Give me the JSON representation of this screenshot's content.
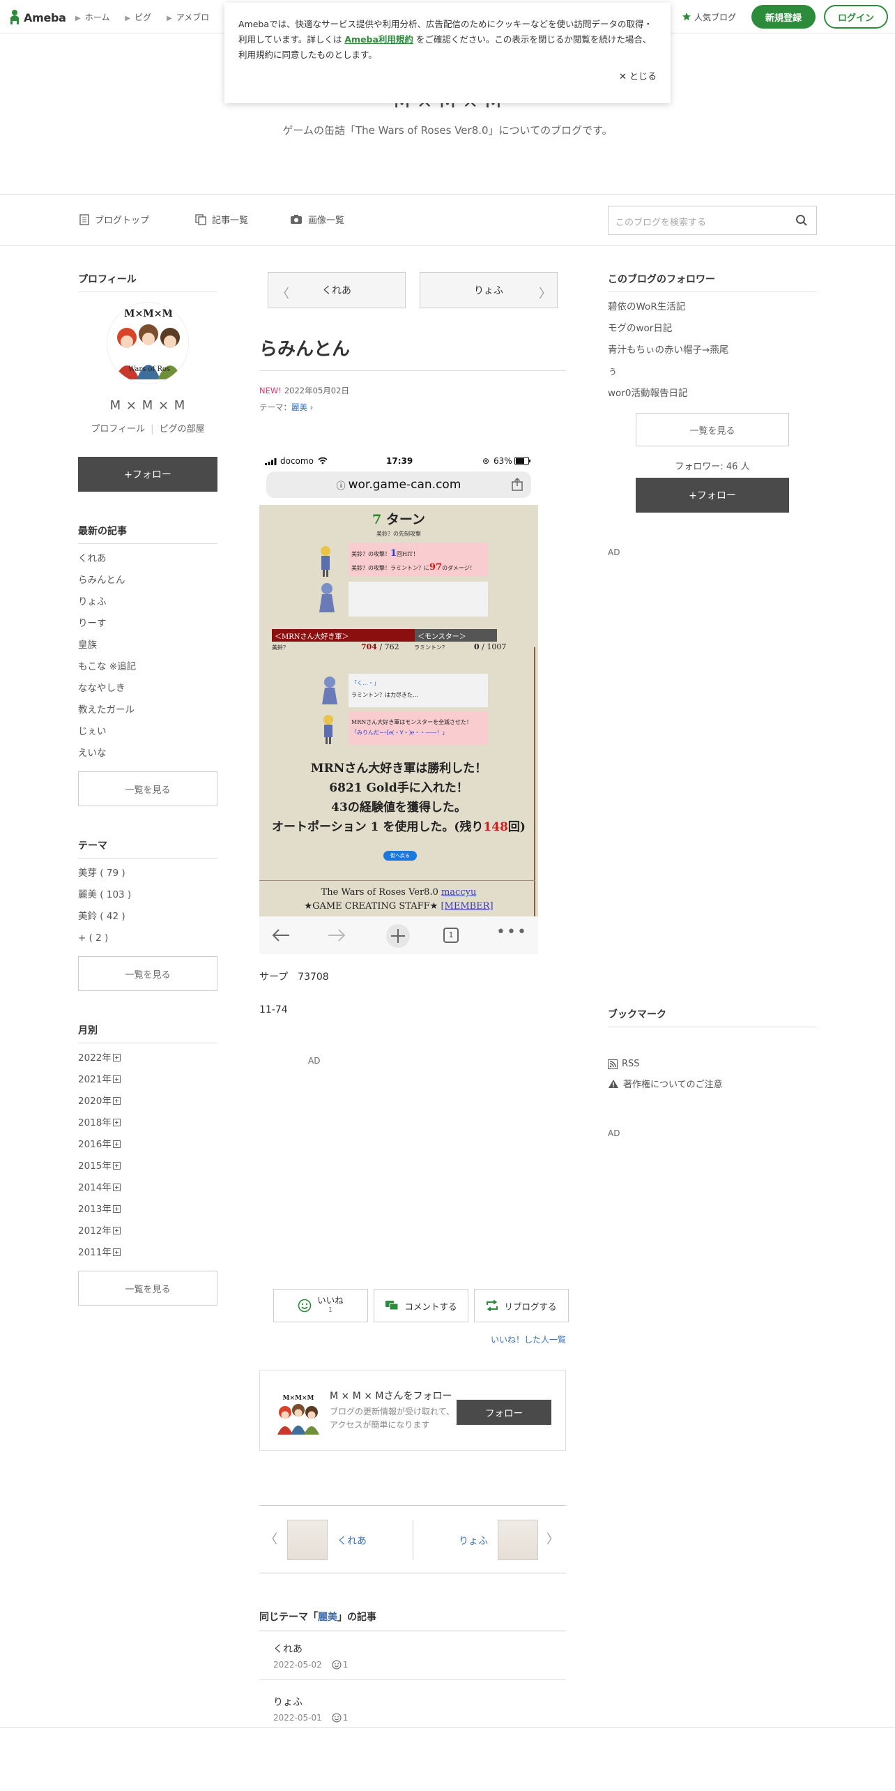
{
  "topbar": {
    "logo": "Ameba",
    "nav": [
      "ホーム",
      "ピグ",
      "アメブロ"
    ],
    "popular": "人気ブログ",
    "signup": "新規登録",
    "login": "ログイン"
  },
  "cookie": {
    "text1": "Amebaでは、快適なサービス提供や利用分析、広告配信のためにクッキーなどを使い訪問データの取得・利用しています。詳しくは",
    "link": "Ameba利用規約",
    "text2": "をご確認ください。この表示を閉じるか閲覧を続けた場合、利用規約に同意したものとします。",
    "close": "とじる"
  },
  "header": {
    "title": "M × M × M",
    "description": "ゲームの缶詰「The Wars of Roses Ver8.0」についてのブログです。"
  },
  "blognav": {
    "top": "ブログトップ",
    "entries": "記事一覧",
    "images": "画像一覧",
    "search_placeholder": "このブログを検索する"
  },
  "left": {
    "profile_heading": "プロフィール",
    "avatar_text": "M×M×M",
    "avatar_sub": "Wars of Ros",
    "name": "M × M × M",
    "profile_link": "プロフィール",
    "pig_link": "ピグの部屋",
    "follow": "+フォロー",
    "recent_heading": "最新の記事",
    "recent": [
      "くれあ",
      "らみんとん",
      "りょふ",
      "りーす",
      "皇族",
      "もこな ※追記",
      "ななやしき",
      "教えたガール",
      "じぇい",
      "えいな"
    ],
    "more": "一覧を見る",
    "theme_heading": "テーマ",
    "themes": [
      "美芽 ( 79 )",
      "麗美 ( 103 )",
      "美鈴 ( 42 )",
      "+ ( 2 )"
    ],
    "monthly_heading": "月別",
    "years": [
      "2022年",
      "2021年",
      "2020年",
      "2018年",
      "2016年",
      "2015年",
      "2014年",
      "2013年",
      "2012年",
      "2011年"
    ]
  },
  "main": {
    "prev": "くれあ",
    "next": "りょふ",
    "title": "らみんとん",
    "new_label": "NEW!",
    "date": "2022年05月02日",
    "theme_label": "テーマ：",
    "theme": "麗美",
    "screenshot": {
      "carrier": "docomo",
      "time": "17:39",
      "battery": "63%",
      "url": "wor.game-can.com",
      "turn_num": "7",
      "turn_label": "ターン",
      "first_attack": "美鈴？の先制攻撃",
      "line1_a": "美鈴？の攻撃！",
      "line1_num": "1",
      "line1_b": "回HIT！",
      "line2_a": "美鈴？の攻撃！ラミントン？に",
      "line2_num": "97",
      "line2_b": "のダメージ！",
      "army_bar": "＜MRNさん大好き軍＞",
      "monster_bar": "＜モンスター＞",
      "ally_name": "美鈴？",
      "ally_hp": "704",
      "ally_max": "762",
      "enemy_name": "ラミントン？",
      "enemy_hp": "0",
      "enemy_max": "1007",
      "enemy_say1": "「く…・」",
      "enemy_say2": "ラミントン？は力尽きた…",
      "win_say1": "MRNさん大好き軍はモンスターを全滅させた！",
      "win_say2": "「みりんだ~ｰ[e(・∀・)e・・――！」",
      "result1": "MRNさん大好き軍は勝利した！",
      "result2": "6821 Gold手に入れた！",
      "result3": "43の経験値を獲得した。",
      "result4a": "オートポーション 1 を使用した。(残り",
      "result4num": "148",
      "result4b": "回)",
      "back_btn": "街へ戻る",
      "footer1a": "The Wars of Roses Ver8.0 ",
      "footer1link": "maccyu",
      "footer2a": "★GAME CREATING STAFF★ ",
      "footer2link": "[MEMBER]",
      "tab_count": "1"
    },
    "text1": "サープ　73708",
    "text2": "11-74",
    "ad": "AD",
    "like": "いいね",
    "like_count": "1",
    "comment": "コメントする",
    "reblog": "リブログする",
    "likers": "いいね！した人一覧",
    "follow_card_title": "M × M × Mさんをフォロー",
    "follow_card_desc": "ブログの更新情報が受け取れて、アクセスが簡単になります",
    "follow_card_btn": "フォロー",
    "pn_prev": "くれあ",
    "pn_next": "りょふ",
    "same_theme_prefix": "同じテーマ「",
    "same_theme_name": "麗美",
    "same_theme_suffix": "」の記事",
    "same_theme": [
      {
        "title": "くれあ",
        "date": "2022-05-02",
        "likes": "1"
      },
      {
        "title": "りょふ",
        "date": "2022-05-01",
        "likes": "1"
      }
    ]
  },
  "right": {
    "followers_heading": "このブログのフォロワー",
    "followers": [
      "碧依のWoR生活記",
      "モグのwor日記",
      "青汁もちぃの赤い帽子→燕尾",
      "ぅ",
      "wor0活動報告日記"
    ],
    "more": "一覧を見る",
    "follower_count_label": "フォロワー: ",
    "follower_count": "46",
    "follower_unit": " 人",
    "follow": "+フォロー",
    "ad1": "AD",
    "bookmark_heading": "ブックマーク",
    "rss": "RSS",
    "copyright": "著作権についてのご注意",
    "ad2": "AD"
  },
  "colors": {
    "brand_green": "#2d8c3c",
    "link_blue": "#3a6fb4",
    "new_pink": "#e6336f",
    "dark_button": "#4a4a4a"
  }
}
